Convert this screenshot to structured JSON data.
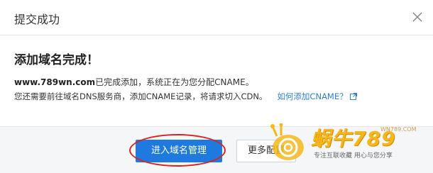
{
  "dialog": {
    "title": "提交成功",
    "heading": "添加域名完成！",
    "domain": "www.789wn.com",
    "line1_rest": "已完成添加，系统正在为您分配CNAME。",
    "line2": "您还需要前往域名DNS服务商，添加CNAME记录，将请求切入CDN。",
    "help_link": "如何添加CNAME？"
  },
  "footer": {
    "primary_button": "进入域名管理",
    "secondary_button": "更多配置"
  },
  "watermark": {
    "brand": "蜗牛789",
    "url": "WN789.COM",
    "slogan": "专注互联收藏  用心与您分享"
  },
  "colors": {
    "primary": "#1f7ae0",
    "link": "#2d7fd8",
    "highlight": "#e02020",
    "watermark": "#f5b81c"
  },
  "icons": {
    "close": "close-icon",
    "external_link": "external-link-icon",
    "snail_logo": "snail-logo-icon"
  }
}
